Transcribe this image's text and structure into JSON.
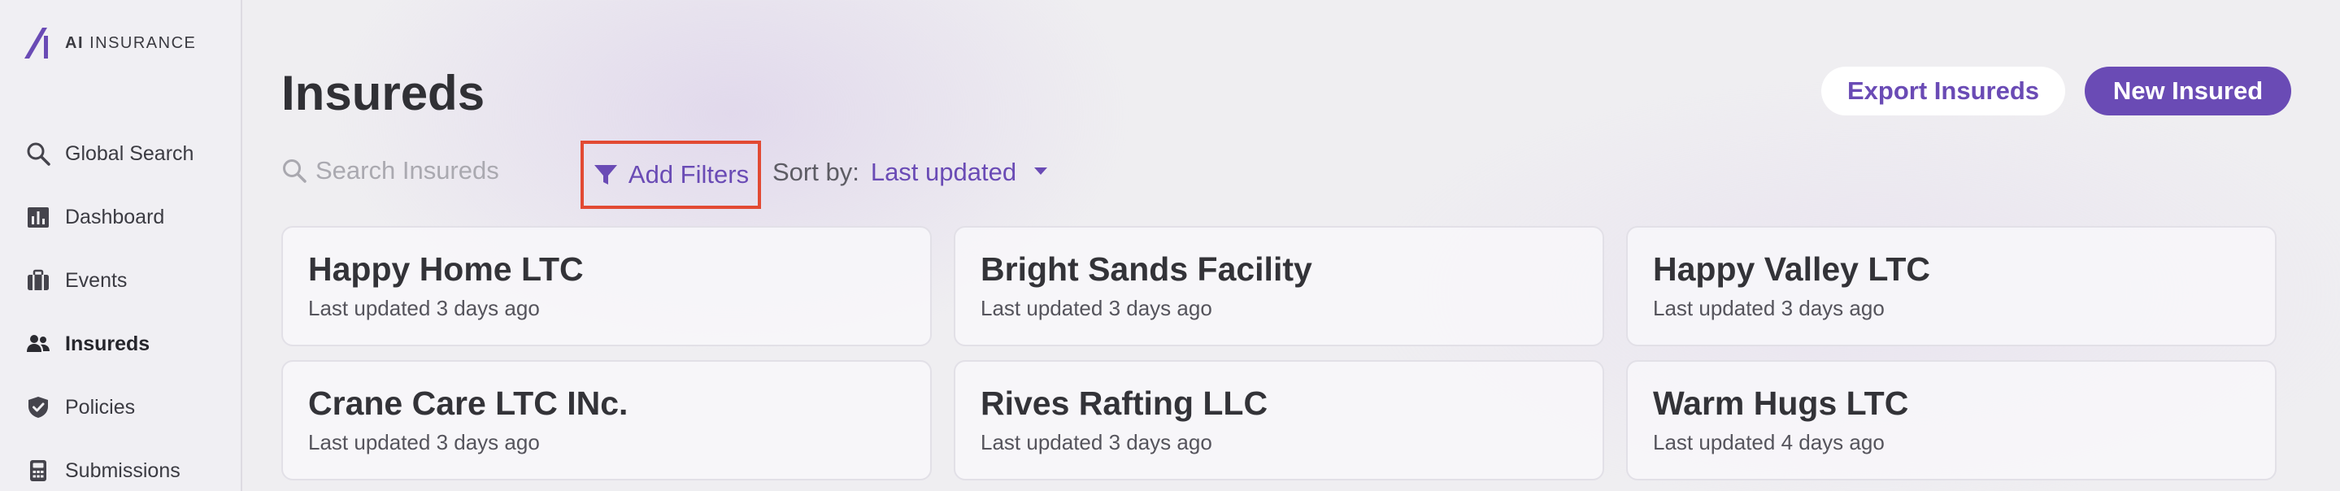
{
  "brand": {
    "mark": "AI",
    "name": "INSURANCE",
    "accent": "#6a4bb5"
  },
  "sidebar": {
    "items": [
      {
        "label": "Global Search",
        "icon": "search-icon",
        "active": false
      },
      {
        "label": "Dashboard",
        "icon": "chart-icon",
        "active": false
      },
      {
        "label": "Events",
        "icon": "briefcase-icon",
        "active": false
      },
      {
        "label": "Insureds",
        "icon": "users-icon",
        "active": true
      },
      {
        "label": "Policies",
        "icon": "shield-check-icon",
        "active": false
      },
      {
        "label": "Submissions",
        "icon": "calculator-icon",
        "active": false
      }
    ]
  },
  "header": {
    "title": "Insureds",
    "export_label": "Export Insureds",
    "new_label": "New Insured"
  },
  "toolbar": {
    "search_placeholder": "Search Insureds",
    "filters_label": "Add Filters",
    "sort_label": "Sort by:",
    "sort_value": "Last updated"
  },
  "insureds": [
    {
      "name": "Happy Home LTC",
      "updated": "Last updated 3 days ago"
    },
    {
      "name": "Bright Sands Facility",
      "updated": "Last updated 3 days ago"
    },
    {
      "name": "Happy Valley LTC",
      "updated": "Last updated 3 days ago"
    },
    {
      "name": "Crane Care LTC INc.",
      "updated": "Last updated 3 days ago"
    },
    {
      "name": "Rives Rafting LLC",
      "updated": "Last updated 3 days ago"
    },
    {
      "name": "Warm Hugs LTC",
      "updated": "Last updated 4 days ago"
    }
  ]
}
